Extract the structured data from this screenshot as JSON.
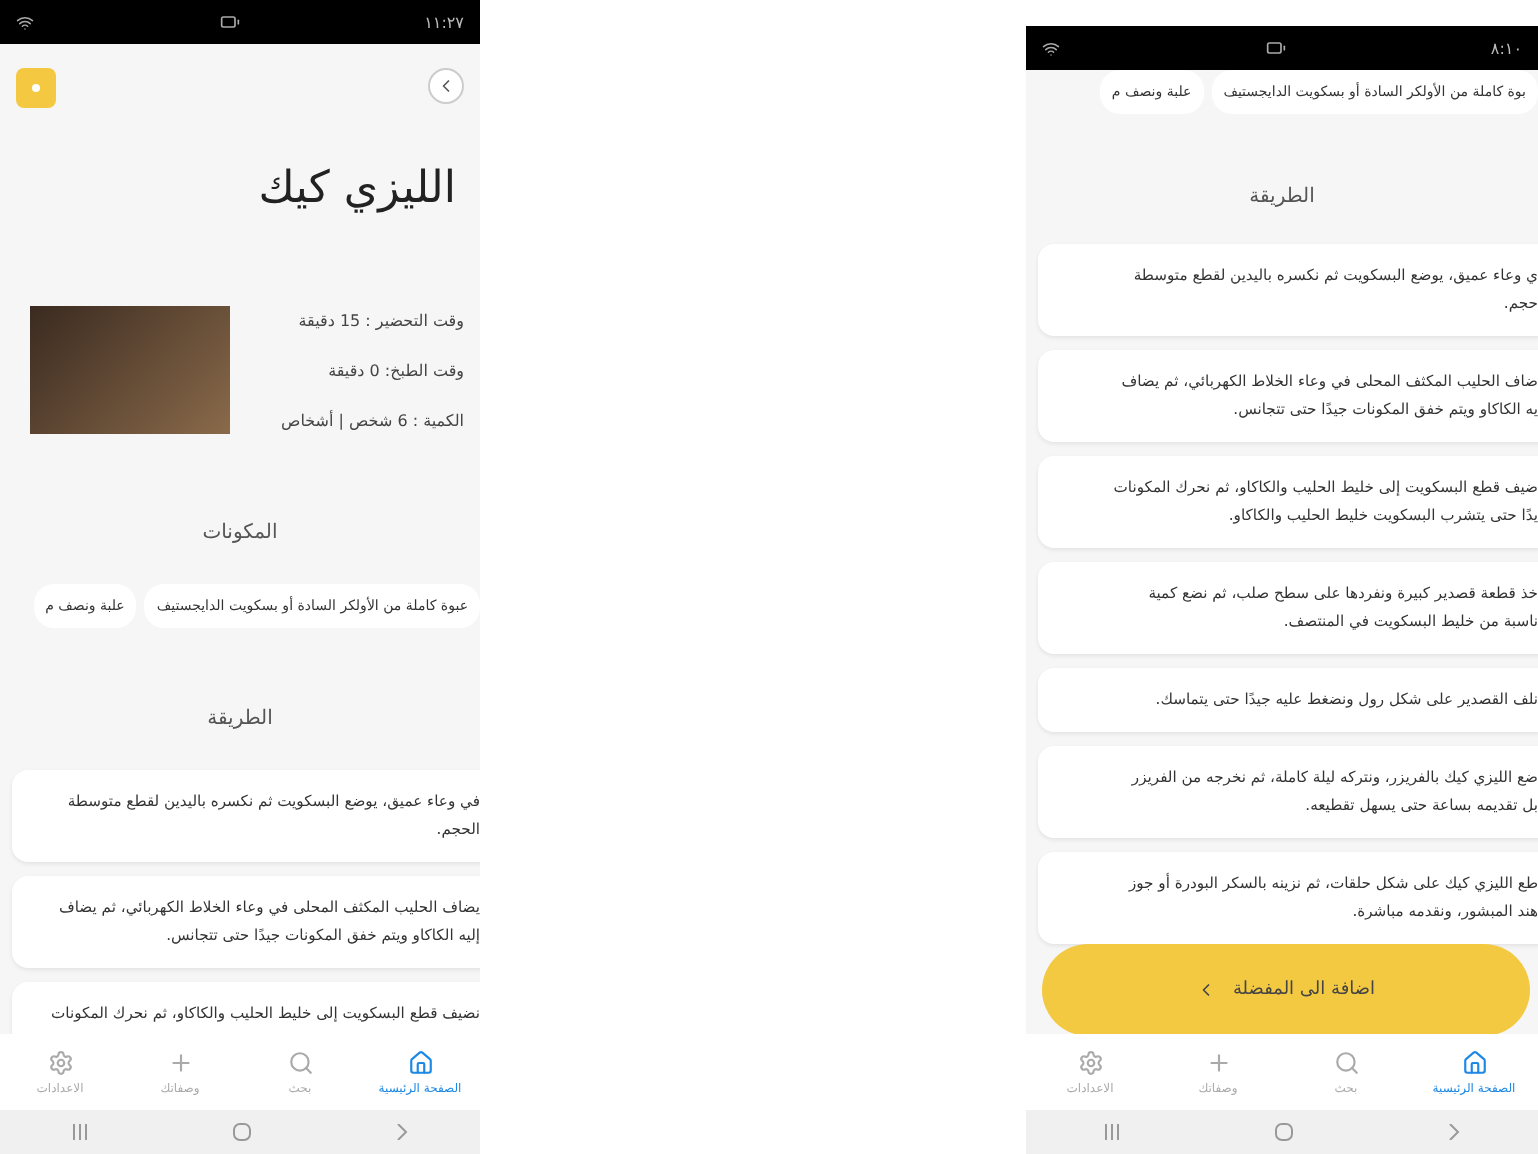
{
  "screens": [
    {
      "status_time": "٨:١٠",
      "ingredients": [
        "بوة كاملة من الأولكر السادة أو بسكويت الدايجستيف",
        "علبة ونصف م"
      ],
      "method_heading": "الطريقة",
      "steps": [
        "ي وعاء عميق، يوضع البسكويت ثم نكسره باليدين لقطع متوسطة\nحجم.",
        "ضاف الحليب المكثف المحلى في وعاء الخلاط الكهربائي، ثم يضاف\nيه الكاكاو ويتم خفق المكونات جيدًا حتى تتجانس.",
        "ضيف قطع البسكويت إلى خليط الحليب والكاكاو، ثم نحرك المكونات\nيدًا حتى يتشرب البسكويت خليط الحليب والكاكاو.",
        "خذ قطعة قصدير كبيرة ونفردها على سطح صلب، ثم نضع كمية\nناسبة من خليط البسكويت في المنتصف.",
        "نلف القصدير على شكل رول ونضغط عليه جيدًا حتى يتماسك.",
        "ضع الليزي كيك بالفريزر، ونتركه ليلة كاملة، ثم نخرجه من الفريزر\nبل تقديمه بساعة حتى يسهل تقطيعه.",
        "طع الليزي كيك على شكل حلقات، ثم نزينه بالسكر البودرة أو جوز\nهند المبشور، ونقدمه مباشرة."
      ],
      "favorite_button": "اضافة الى المفضلة",
      "nav": [
        {
          "label": "الصفحة الرئيسية",
          "selected": true
        },
        {
          "label": "بحث",
          "selected": false
        },
        {
          "label": "وصفاتك",
          "selected": false
        },
        {
          "label": "الاعدادات",
          "selected": false
        }
      ]
    },
    {
      "status_time": "١١:٢٧",
      "title": "الليزي كيك",
      "info": [
        "وقت التحضير : 15 دقيقة",
        "وقت الطبخ: 0 دقيقة",
        "الكمية : 6 شخص | أشخاص"
      ],
      "ingredients_heading": "المكونات",
      "ingredients": [
        "عبوة كاملة من الأولكر السادة أو بسكويت الدايجستيف",
        "علبة ونصف م"
      ],
      "method_heading": "الطريقة",
      "steps": [
        "في وعاء عميق، يوضع البسكويت ثم نكسره باليدين لقطع متوسطة\nالحجم.",
        "يضاف الحليب المكثف المحلى في وعاء الخلاط الكهربائي، ثم يضاف\nإليه الكاكاو ويتم خفق المكونات جيدًا حتى تتجانس.",
        "نضيف قطع البسكويت إلى خليط الحليب والكاكاو، ثم نحرك المكونات"
      ],
      "nav": [
        {
          "label": "الصفحة الرئيسية",
          "selected": true
        },
        {
          "label": "بحث",
          "selected": false
        },
        {
          "label": "وصفاتك",
          "selected": false
        },
        {
          "label": "الاعدادات",
          "selected": false
        }
      ]
    }
  ]
}
